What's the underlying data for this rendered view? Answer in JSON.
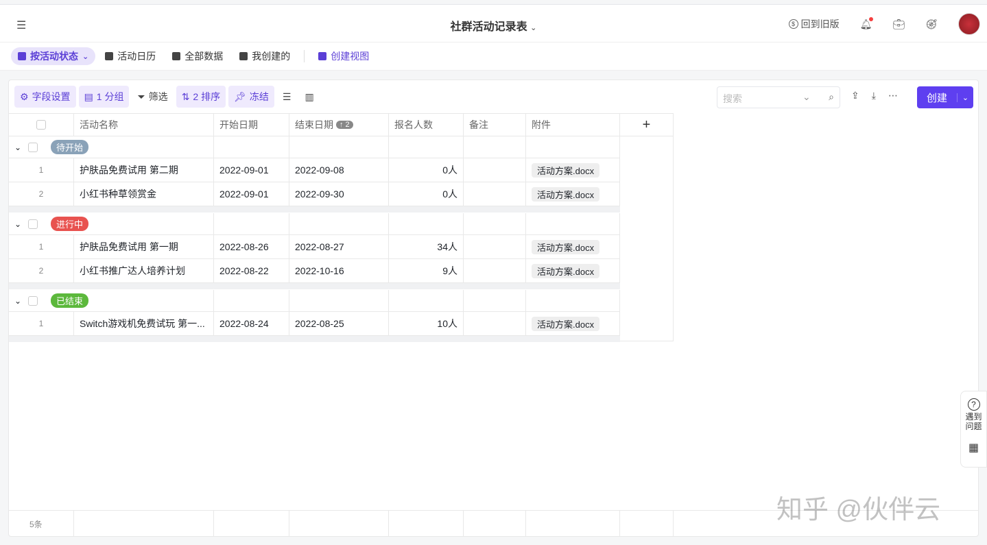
{
  "header": {
    "title": "社群活动记录表",
    "back_old": "回到旧版"
  },
  "views": [
    {
      "label": "按活动状态",
      "active": true
    },
    {
      "label": "活动日历"
    },
    {
      "label": "全部数据"
    },
    {
      "label": "我创建的"
    }
  ],
  "create_view": "创建视图",
  "toolbar": {
    "fields": "字段设置",
    "group": "1 分组",
    "filter": "筛选",
    "sort": "2 排序",
    "freeze": "冻结",
    "search_placeholder": "搜索",
    "create": "创建"
  },
  "columns": [
    "活动名称",
    "开始日期",
    "结束日期",
    "报名人数",
    "备注",
    "附件"
  ],
  "sort_badge": "↑ 2",
  "groups": [
    {
      "status": "待开始",
      "color": "#8aa2b8",
      "rows": [
        {
          "i": "1",
          "name": "护肤品免费试用 第二期",
          "start": "2022-09-01",
          "end": "2022-09-08",
          "count": "0人",
          "file": "活动方案.docx"
        },
        {
          "i": "2",
          "name": "小红书种草领赏金",
          "start": "2022-09-01",
          "end": "2022-09-30",
          "count": "0人",
          "file": "活动方案.docx"
        }
      ]
    },
    {
      "status": "进行中",
      "color": "#e8524f",
      "rows": [
        {
          "i": "1",
          "name": "护肤品免费试用 第一期",
          "start": "2022-08-26",
          "end": "2022-08-27",
          "count": "34人",
          "file": "活动方案.docx"
        },
        {
          "i": "2",
          "name": "小红书推广达人培养计划",
          "start": "2022-08-22",
          "end": "2022-10-16",
          "count": "9人",
          "file": "活动方案.docx"
        }
      ]
    },
    {
      "status": "已结束",
      "color": "#5cb83c",
      "rows": [
        {
          "i": "1",
          "name": "Switch游戏机免费试玩 第一...",
          "start": "2022-08-24",
          "end": "2022-08-25",
          "count": "10人",
          "file": "活动方案.docx"
        }
      ]
    }
  ],
  "footer": {
    "count": "5条"
  },
  "help": {
    "label": "遇到问题"
  },
  "watermark": "知乎 @伙伴云"
}
